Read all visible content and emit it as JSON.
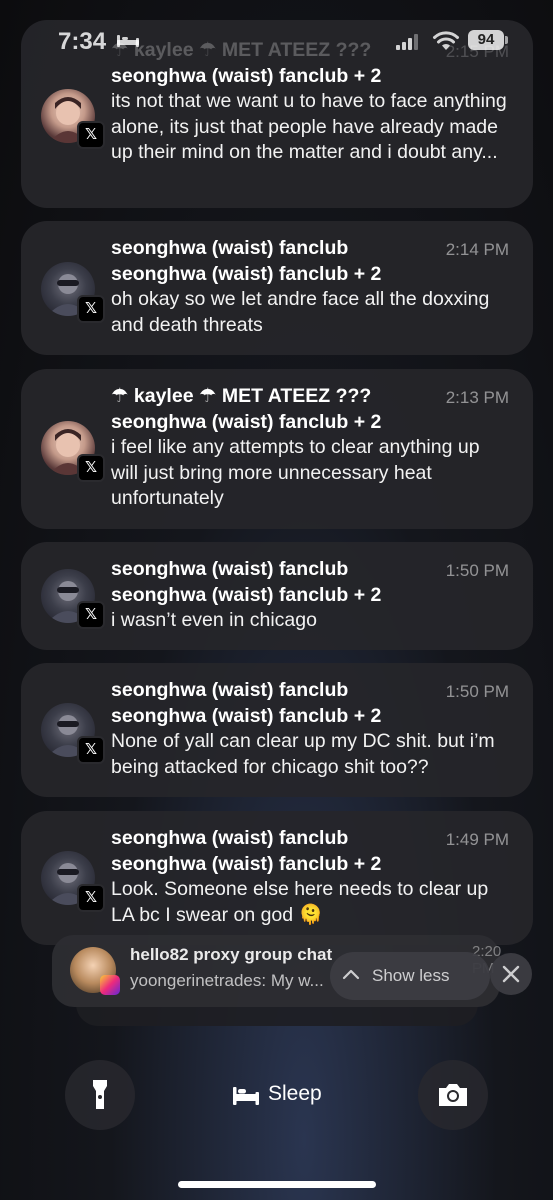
{
  "status_bar": {
    "time": "7:34",
    "battery": "94"
  },
  "notifications": [
    {
      "sender": "☂ kaylee ☂ MET ATEEZ ???",
      "time": "2:15 PM",
      "group": "seonghwa (waist) fanclub + 2",
      "body": "its not that we want u to have to face anything alone, its just that people have already made up their mind on the matter and i doubt any...",
      "avatar": "avatar-kaylee",
      "app_badge": "𝕏"
    },
    {
      "sender": "seonghwa (waist) fanclub",
      "time": "2:14 PM",
      "group": "seonghwa (waist) fanclub + 2",
      "body": "oh okay so we let andre face all the doxxing and death threats",
      "avatar": "avatar-seonghwa",
      "app_badge": "𝕏"
    },
    {
      "sender": "☂ kaylee ☂ MET ATEEZ ???",
      "time": "2:13 PM",
      "group": "seonghwa (waist) fanclub + 2",
      "body": "i feel like any attempts to clear anything up will just bring more unnecessary heat unfortunately",
      "avatar": "avatar-kaylee",
      "app_badge": "𝕏"
    },
    {
      "sender": "seonghwa (waist) fanclub",
      "time": "1:50 PM",
      "group": "seonghwa (waist) fanclub + 2",
      "body": "i wasn’t even in chicago",
      "avatar": "avatar-seonghwa",
      "app_badge": "𝕏"
    },
    {
      "sender": "seonghwa (waist) fanclub",
      "time": "1:50 PM",
      "group": "seonghwa (waist) fanclub + 2",
      "body": "None of yall can clear up my DC shit. but i’m being attacked for chicago shit too??",
      "avatar": "avatar-seonghwa",
      "app_badge": "𝕏"
    },
    {
      "sender": "seonghwa (waist) fanclub",
      "time": "1:49 PM",
      "group": "seonghwa (waist) fanclub + 2",
      "body": "Look. Someone else here needs to clear up LA bc I swear on god 🫠",
      "avatar": "avatar-seonghwa",
      "app_badge": "𝕏"
    }
  ],
  "collapsed_stack": {
    "title": "hello82 proxy group chat",
    "time": "2:20 PM",
    "preview": "yoongerinetrades: My w...",
    "show_less_label": "Show less"
  },
  "bottom": {
    "sleep_label": "Sleep"
  },
  "colors": {
    "card": "#26262a",
    "text": "#ffffff",
    "muted": "#8e8e93"
  }
}
